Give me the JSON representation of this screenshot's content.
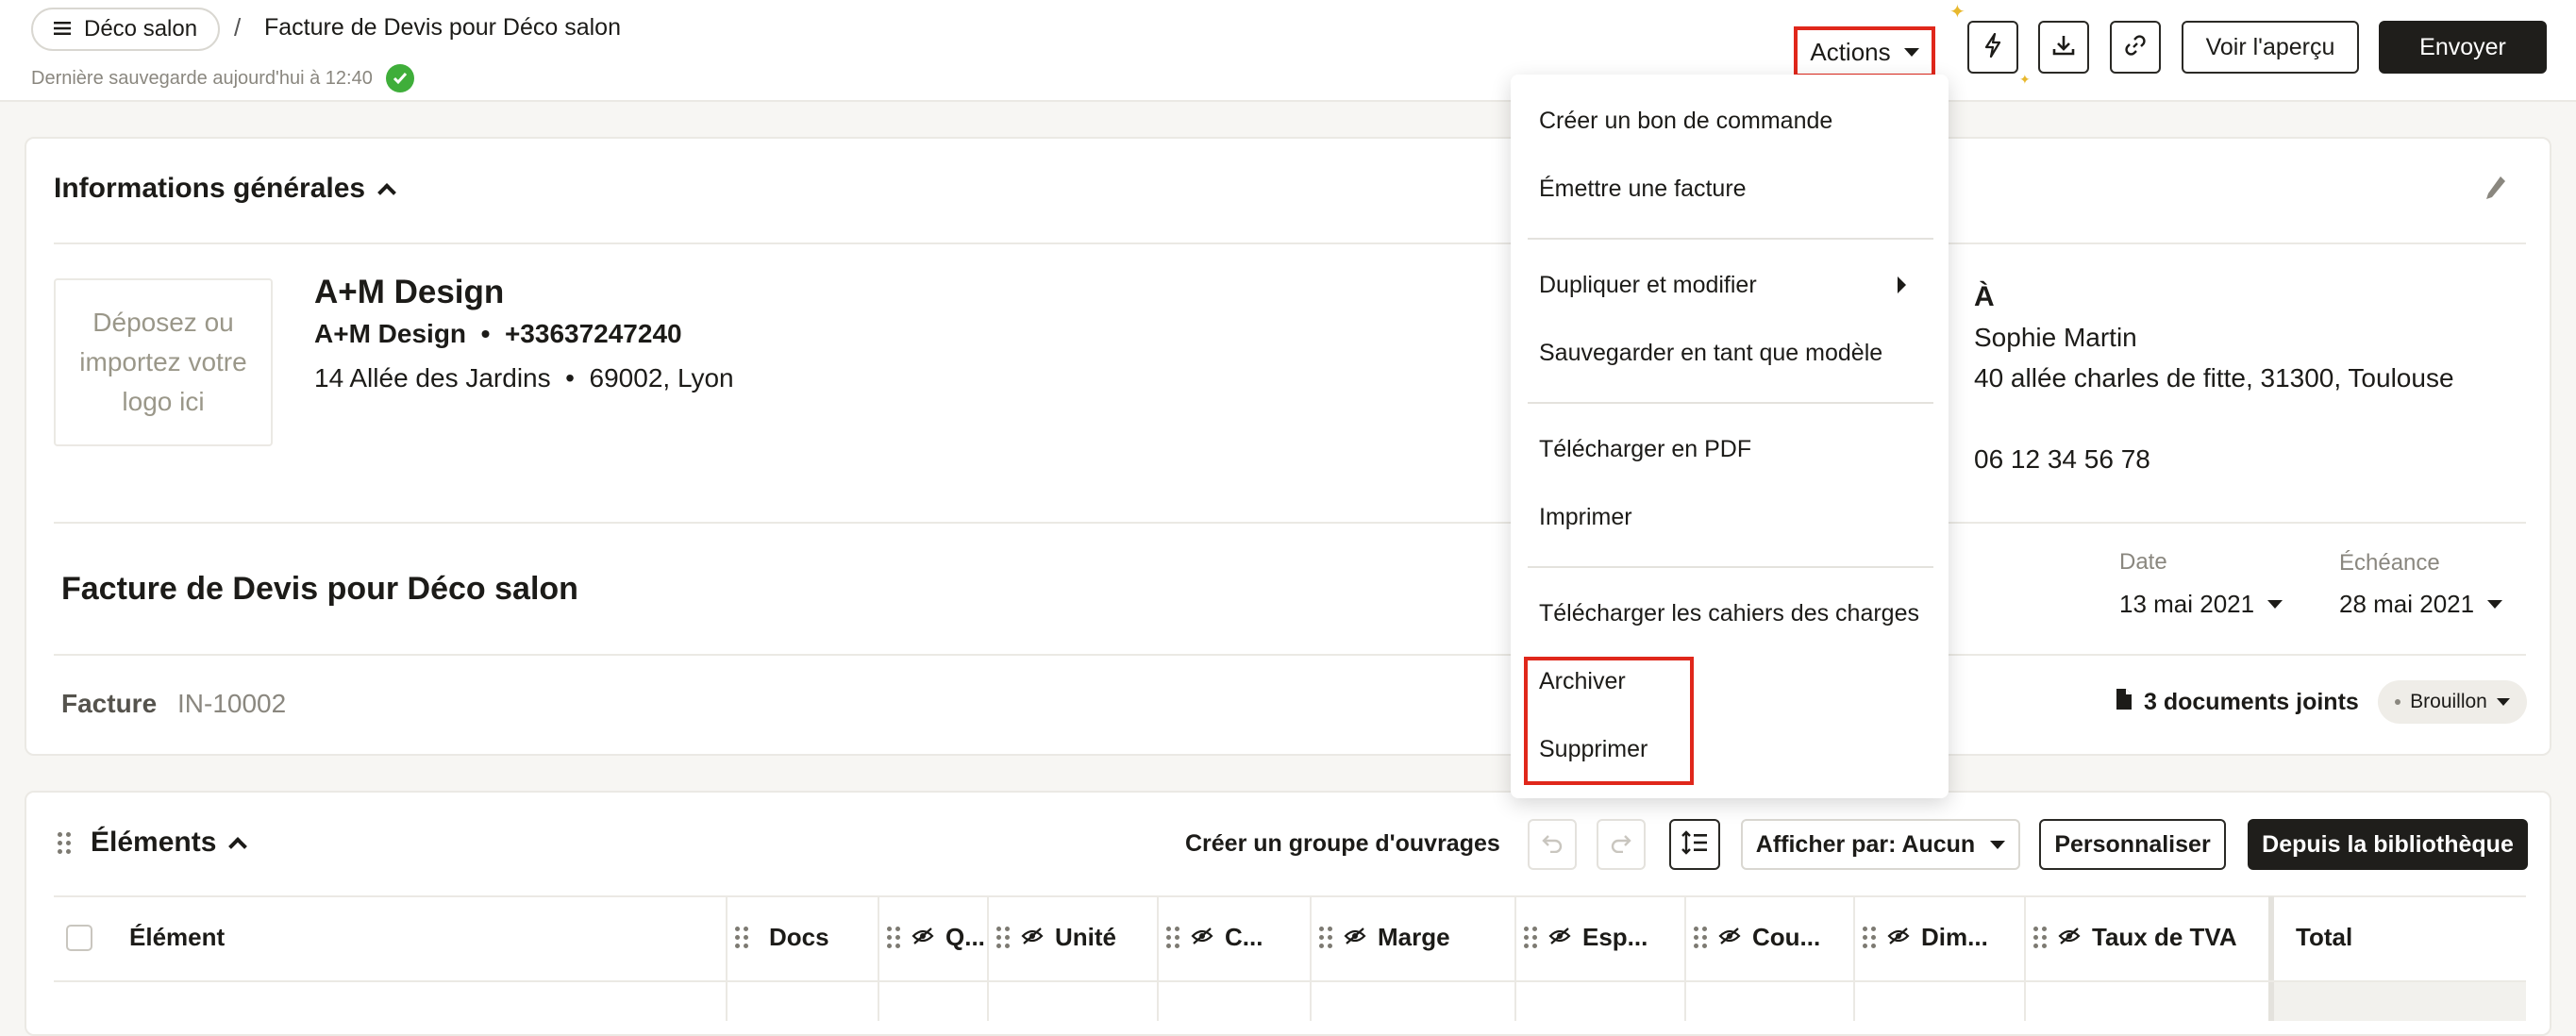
{
  "header": {
    "project_label": "Déco salon",
    "separator": "/",
    "title": "Facture de Devis pour Déco salon",
    "saved_text": "Dernière sauvegarde aujourd'hui à 12:40",
    "actions_label": "Actions",
    "preview_label": "Voir l'aperçu",
    "send_label": "Envoyer",
    "icons": [
      "bolt-icon",
      "download-icon",
      "link-icon"
    ]
  },
  "general": {
    "title": "Informations générales",
    "logo_placeholder": "Déposez ou importez votre logo ici",
    "company_name": "A+M Design",
    "company_line": "A+M Design  •  +33637247240",
    "company_address": "14 Allée des Jardins  •  69002, Lyon",
    "to_label": "À",
    "client_name": "Sophie Martin",
    "client_address": "40 allée charles de fitte, 31300, Toulouse",
    "client_phone": "06 12 34 56 78",
    "doc_title": "Facture de Devis pour Déco salon",
    "date_label": "Date",
    "date_value": "13 mai 2021",
    "due_label": "Échéance",
    "due_value": "28 mai 2021",
    "invoice_label": "Facture",
    "invoice_number": "IN-10002",
    "attachments": "3 documents joints",
    "status": "Brouillon"
  },
  "menu": {
    "items": [
      "Créer un bon de commande",
      "Émettre une facture",
      "Dupliquer et modifier",
      "Sauvegarder en tant que modèle",
      "Télécharger en PDF",
      "Imprimer",
      "Télécharger les cahiers des charges",
      "Archiver",
      "Supprimer"
    ]
  },
  "elements": {
    "title": "Éléments",
    "create_group": "Créer un groupe d'ouvrages",
    "display_by": "Afficher par: Aucun",
    "customize": "Personnaliser",
    "from_library": "Depuis la bibliothèque",
    "columns": [
      "Élément",
      "Docs",
      "Q...",
      "Unité",
      "C...",
      "Marge",
      "Esp...",
      "Cou...",
      "Dim...",
      "Taux de TVA",
      "Total"
    ]
  },
  "colors": {
    "accent_red": "#e0271b",
    "success_green": "#3fae3a",
    "dark": "#1f1e1b"
  }
}
